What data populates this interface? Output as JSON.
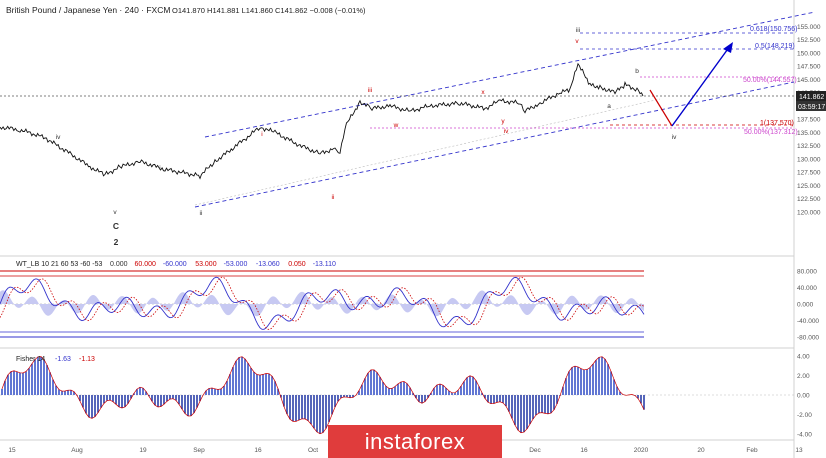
{
  "header": {
    "symbol_title": "British Pound / Japanese Yen · 240 · FXCM",
    "ohlc": "O141.870 H141.881 L141.860 C141.862 −0.008 (−0.01%)"
  },
  "price_axis": {
    "ticks": [
      "155.000",
      "152.500",
      "150.000",
      "147.500",
      "145.000",
      "142.500",
      "140.000",
      "137.500",
      "135.000",
      "132.500",
      "130.000",
      "127.500",
      "125.000",
      "122.500",
      "120.000"
    ],
    "current_price": "141.862",
    "countdown": "03:59:17"
  },
  "annotations": {
    "fib_618": "0.618(150.756)",
    "fib_5": "0.5(148.219)",
    "fib_50a": "50.00%(144.557)",
    "fib_1": "1(137.570)",
    "fib_50b": "50.00%(137.312)"
  },
  "wave_labels": [
    {
      "text": "iv",
      "color": "#333333"
    },
    {
      "text": "v",
      "color": "#333333"
    },
    {
      "text": "C",
      "color": "#333333"
    },
    {
      "text": "2",
      "color": "#333333"
    },
    {
      "text": "i",
      "color": "#333333"
    },
    {
      "text": "ii",
      "color": "#333333"
    },
    {
      "text": "i",
      "color": "#cc0000"
    },
    {
      "text": "ii",
      "color": "#cc0000"
    },
    {
      "text": "iii",
      "color": "#cc0000"
    },
    {
      "text": "w",
      "color": "#cc0000"
    },
    {
      "text": "x",
      "color": "#cc0000"
    },
    {
      "text": "y",
      "color": "#cc0000"
    },
    {
      "text": "iv",
      "color": "#cc0000"
    },
    {
      "text": "v",
      "color": "#cc0000"
    },
    {
      "text": "iii",
      "color": "#333333"
    },
    {
      "text": "a",
      "color": "#333333"
    },
    {
      "text": "b",
      "color": "#333333"
    },
    {
      "text": "iv",
      "color": "#333333"
    }
  ],
  "wt_panel": {
    "legend": "WT_LB 10 21 60 53 -60 -53",
    "values": [
      "0.000",
      "60.000",
      "-60.000",
      "53.000",
      "-53.000",
      "-13.060",
      "0.050",
      "-13.110"
    ],
    "value_colors": [
      "#333333",
      "#cc0000",
      "#3333cc",
      "#cc0000",
      "#3333cc",
      "#3333cc",
      "#cc0000",
      "#3333cc"
    ],
    "ticks": [
      "80.000",
      "40.000",
      "0.000",
      "-40.000",
      "-80.000"
    ]
  },
  "fisher_panel": {
    "legend": "Fisher 14",
    "values": [
      "-1.63",
      "-1.13"
    ],
    "value_colors": [
      "#3333cc",
      "#cc0000"
    ],
    "ticks": [
      "4.00",
      "2.00",
      "0.00",
      "-2.00",
      "-4.00"
    ]
  },
  "time_axis": {
    "labels": [
      "15",
      "Aug",
      "19",
      "Sep",
      "16",
      "Oct",
      "Dec",
      "16",
      "2020",
      "20",
      "Feb",
      "13"
    ]
  },
  "watermark": "instaforex",
  "chart_data": {
    "type": "line",
    "title": "British Pound / Japanese Yen · 240 · FXCM",
    "ylim": [
      120,
      155
    ],
    "x_ticks": [
      "15",
      "Aug",
      "19",
      "Sep",
      "16",
      "Oct",
      "Dec",
      "16",
      "2020",
      "20",
      "Feb",
      "13"
    ],
    "series": [
      {
        "values": [
          136.0,
          135.5,
          134.0,
          131.0,
          128.5,
          127.0,
          128.5,
          129.5,
          128.0,
          126.8,
          129.5,
          133.0,
          136.0,
          135.0,
          132.5,
          131.0,
          132.0,
          131.0,
          136.0,
          140.8,
          139.5,
          140.0,
          139.0,
          140.0,
          140.5,
          139.5,
          141.0,
          140.5,
          139.0,
          140.5,
          142.5,
          143.0,
          147.9,
          144.0,
          143.5,
          142.5,
          144.0,
          142.8,
          141.86
        ]
      },
      {
        "values": [
          141.86,
          138.0,
          144.0,
          149.0
        ]
      }
    ],
    "reference_levels": [
      150.756,
      148.219,
      144.557,
      137.57,
      137.312
    ],
    "grid": false
  }
}
